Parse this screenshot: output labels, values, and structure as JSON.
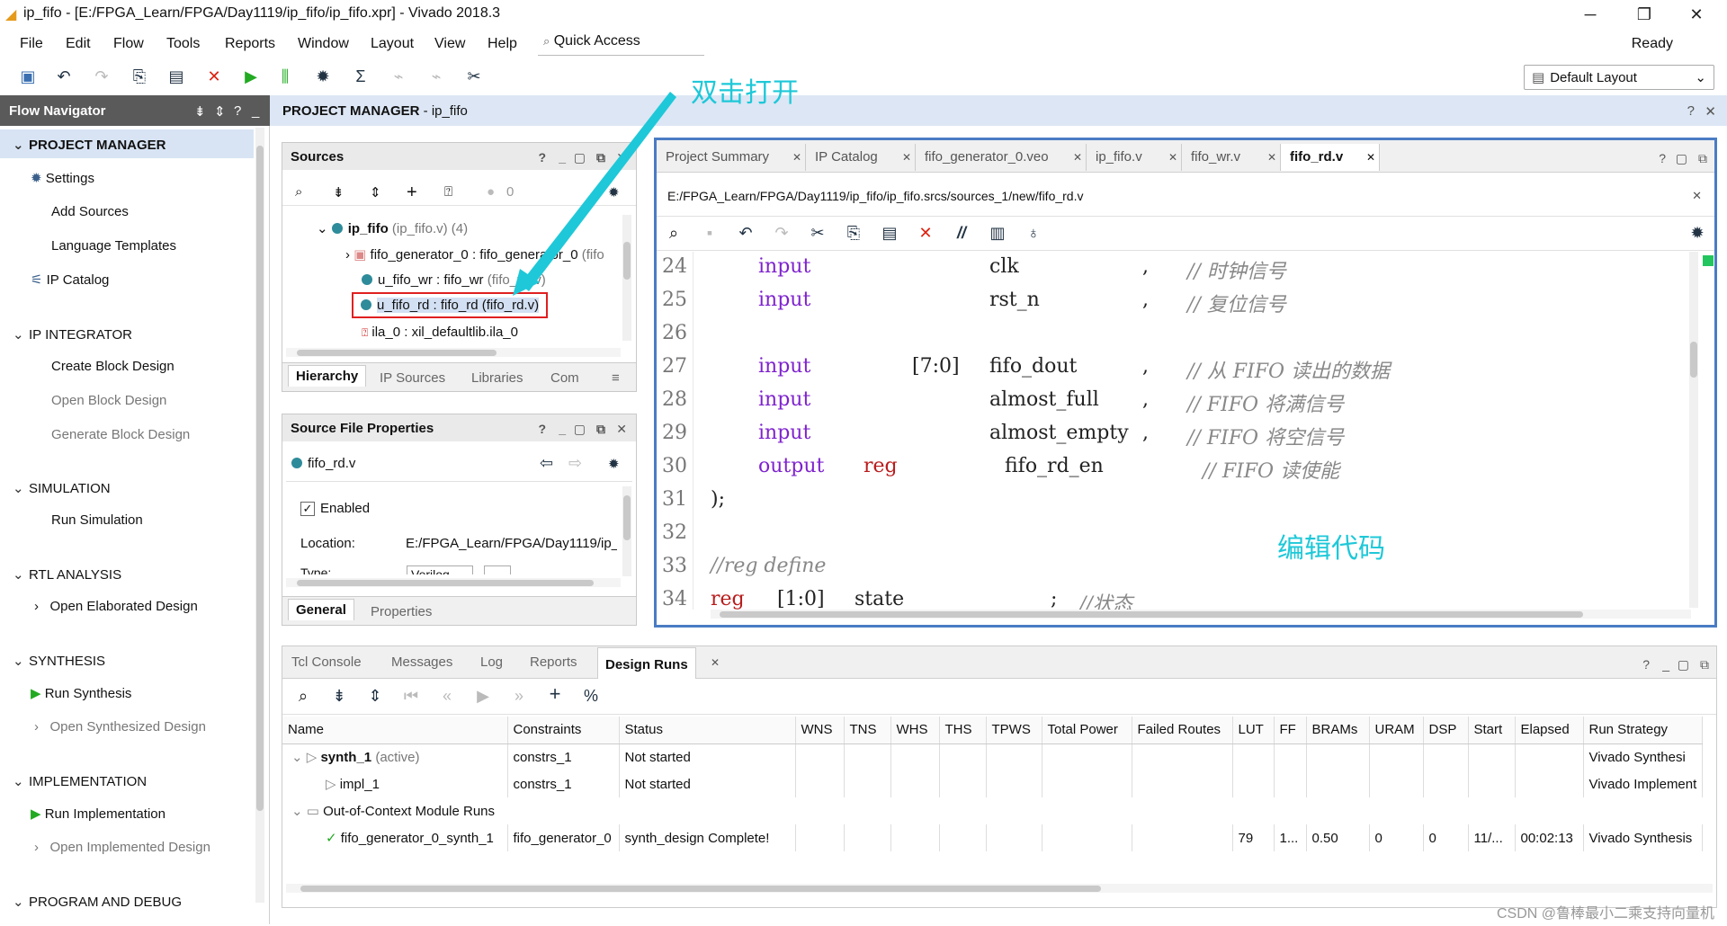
{
  "window": {
    "title": "ip_fifo - [E:/FPGA_Learn/FPGA/Day1119/ip_fifo/ip_fifo.xpr] - Vivado 2018.3"
  },
  "menu": [
    "File",
    "Edit",
    "Flow",
    "Tools",
    "Reports",
    "Window",
    "Layout",
    "View",
    "Help"
  ],
  "quick_access": "Quick Access",
  "status": "Ready",
  "layout_select": "Default Layout",
  "flow_nav": {
    "title": "Flow Navigator",
    "sections": {
      "pm": "PROJECT MANAGER",
      "pm_settings": "Settings",
      "pm_add": "Add Sources",
      "pm_lang": "Language Templates",
      "pm_ip": "IP Catalog",
      "ipi": "IP INTEGRATOR",
      "ipi_create": "Create Block Design",
      "ipi_open": "Open Block Design",
      "ipi_gen": "Generate Block Design",
      "sim": "SIMULATION",
      "sim_run": "Run Simulation",
      "rtl": "RTL ANALYSIS",
      "rtl_open": "Open Elaborated Design",
      "syn": "SYNTHESIS",
      "syn_run": "Run Synthesis",
      "syn_open": "Open Synthesized Design",
      "impl": "IMPLEMENTATION",
      "impl_run": "Run Implementation",
      "impl_open": "Open Implemented Design",
      "prog": "PROGRAM AND DEBUG"
    }
  },
  "pm_header": {
    "bold": "PROJECT MANAGER",
    "rest": " - ip_fifo"
  },
  "sources": {
    "title": "Sources",
    "count": "0",
    "tree": {
      "top": "ip_fifo",
      "top_sub": "(ip_fifo.v) (4)",
      "gen": "fifo_generator_0 : fifo_generator_0",
      "gen_sub": "(fifo",
      "wr": "u_fifo_wr : fifo_wr",
      "wr_sub": "(fifo_wr.v)",
      "rd": "u_fifo_rd : fifo_rd (fifo_rd.v)",
      "ila": "ila_0 : xil_defaultlib.ila_0"
    },
    "tabs": {
      "hier": "Hierarchy",
      "ips": "IP Sources",
      "libs": "Libraries",
      "comp": "Com"
    }
  },
  "sfp": {
    "title": "Source File Properties",
    "file": "fifo_rd.v",
    "enabled": "Enabled",
    "location_label": "Location:",
    "location_value": "E:/FPGA_Learn/FPGA/Day1119/ip_f",
    "type_label": "Type:",
    "type_value": "Verilog",
    "tabs": {
      "general": "General",
      "props": "Properties"
    }
  },
  "editor": {
    "tabs": [
      "Project Summary",
      "IP Catalog",
      "fifo_generator_0.veo",
      "ip_fifo.v",
      "fifo_wr.v",
      "fifo_rd.v"
    ],
    "path": "E:/FPGA_Learn/FPGA/Day1119/ip_fifo/ip_fifo.srcs/sources_1/new/fifo_rd.v",
    "lines": {
      "l24": {
        "n": "24",
        "kw": "input",
        "range": "",
        "name": "clk",
        "sep": ",",
        "cmt": "// 时钟信号"
      },
      "l25": {
        "n": "25",
        "kw": "input",
        "range": "",
        "name": "rst_n",
        "sep": ",",
        "cmt": "// 复位信号"
      },
      "l26": {
        "n": "26"
      },
      "l27": {
        "n": "27",
        "kw": "input",
        "range": "[7:0]",
        "name": "fifo_dout",
        "sep": ",",
        "cmt": "// 从 FIFO 读出的数据"
      },
      "l28": {
        "n": "28",
        "kw": "input",
        "range": "",
        "name": "almost_full",
        "sep": ",",
        "cmt": "// FIFO 将满信号"
      },
      "l29": {
        "n": "29",
        "kw": "input",
        "range": "",
        "name": "almost_empty",
        "sep": ",",
        "cmt": "// FIFO 将空信号"
      },
      "l30": {
        "n": "30",
        "kw": "output",
        "reg": "reg",
        "name": "fifo_rd_en",
        "cmt": "// FIFO 读使能"
      },
      "l31": {
        "n": "31",
        "text": ");"
      },
      "l32": {
        "n": "32"
      },
      "l33": {
        "n": "33",
        "cmt": "//reg define"
      },
      "l34": {
        "n": "34",
        "reg": "reg",
        "range": "[1:0]",
        "name": "state",
        "sep": ";",
        "cmt": "//状态"
      }
    }
  },
  "annotations": {
    "open": "双击打开",
    "edit": "编辑代码"
  },
  "console": {
    "tabs": [
      "Tcl Console",
      "Messages",
      "Log",
      "Reports",
      "Design Runs"
    ],
    "headers": [
      "Name",
      "Constraints",
      "Status",
      "WNS",
      "TNS",
      "WHS",
      "THS",
      "TPWS",
      "Total Power",
      "Failed Routes",
      "LUT",
      "FF",
      "BRAMs",
      "URAM",
      "DSP",
      "Start",
      "Elapsed",
      "Run Strategy"
    ],
    "rows": {
      "synth": {
        "name": "synth_1",
        "active": "(active)",
        "constraints": "constrs_1",
        "status": "Not started",
        "strategy": "Vivado Synthesi"
      },
      "impl": {
        "name": "impl_1",
        "constraints": "constrs_1",
        "status": "Not started",
        "strategy": "Vivado Implement"
      },
      "ooc": {
        "name": "Out-of-Context Module Runs"
      },
      "gen": {
        "name": "fifo_generator_0_synth_1",
        "constraints": "fifo_generator_0",
        "status": "synth_design Complete!",
        "lut": "79",
        "ff": "1...",
        "brams": "0.50",
        "uram": "0",
        "dsp": "0",
        "start": "11/...",
        "elapsed": "00:02:13",
        "strategy": "Vivado Synthesis"
      }
    }
  },
  "watermark": "CSDN @鲁棒最小二乘支持向量机"
}
